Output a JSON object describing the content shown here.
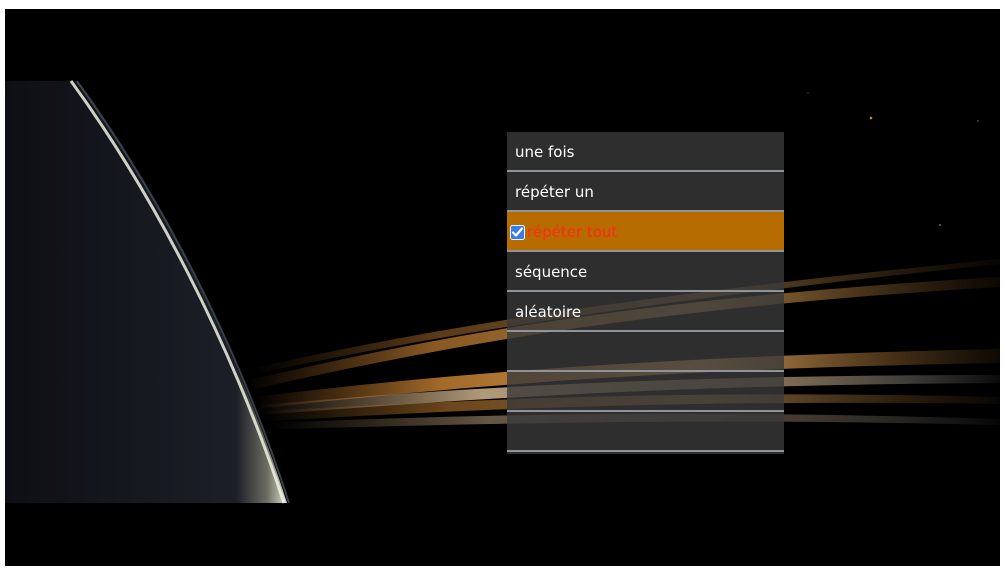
{
  "menu": {
    "items": [
      {
        "label": "une fois",
        "selected": false
      },
      {
        "label": "répéter un",
        "selected": false
      },
      {
        "label": "répéter tout",
        "selected": true
      },
      {
        "label": "séquence",
        "selected": false
      },
      {
        "label": "aléatoire",
        "selected": false
      },
      {
        "label": "",
        "selected": false
      },
      {
        "label": "",
        "selected": false
      },
      {
        "label": "",
        "selected": false
      }
    ]
  },
  "colors": {
    "background": "#000000",
    "menu_panel": "#3a3a3a",
    "selected_row": "#b76c00",
    "selected_text": "#ff2a1a",
    "item_text": "#ffffff",
    "divider": "#8e949a",
    "check_box": "#3a7ee0"
  },
  "icons": {
    "selected_marker": "check-icon"
  }
}
